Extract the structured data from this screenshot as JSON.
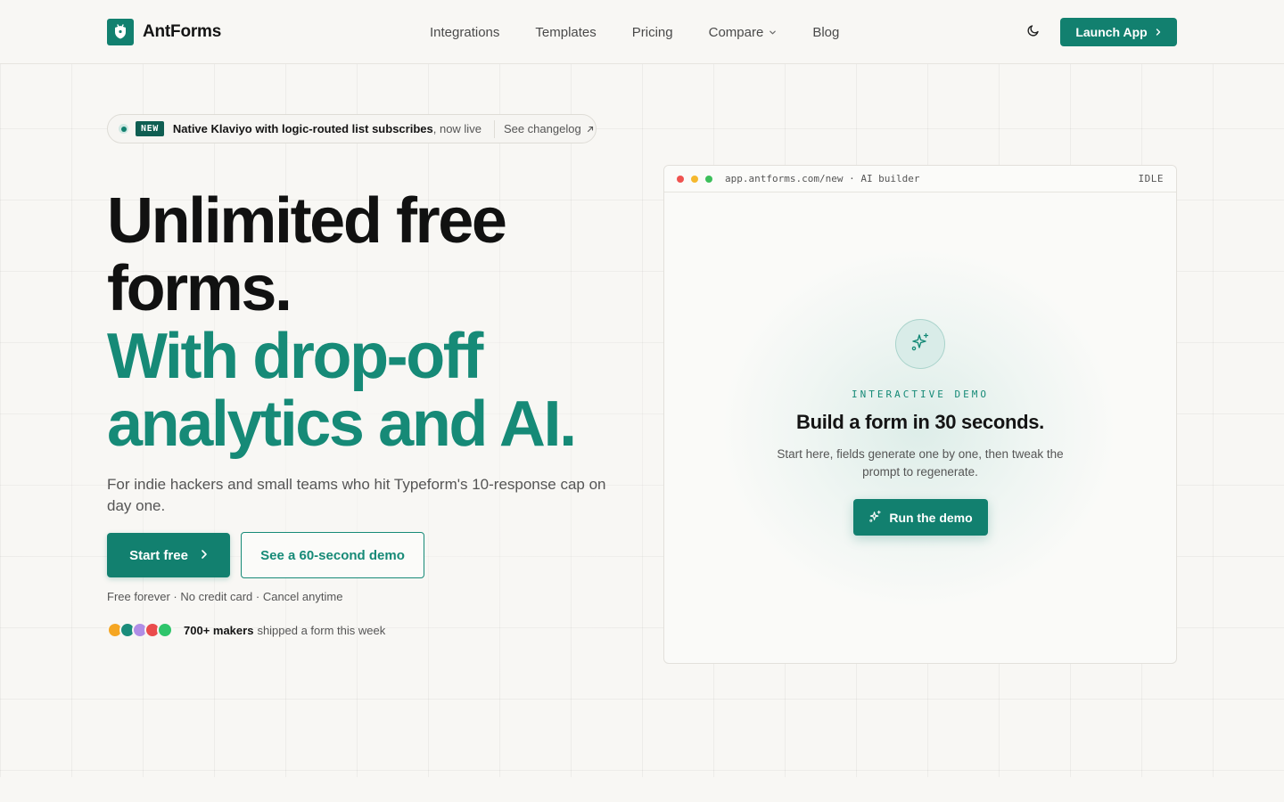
{
  "header": {
    "brand": "AntForms",
    "nav": [
      {
        "label": "Integrations"
      },
      {
        "label": "Templates"
      },
      {
        "label": "Pricing"
      },
      {
        "label": "Compare"
      },
      {
        "label": "Blog"
      }
    ],
    "launch_label": "Launch App"
  },
  "announcement": {
    "badge": "NEW",
    "headline": "Native Klaviyo with logic-routed list subscribes",
    "suffix": ", now live",
    "link": "See changelog"
  },
  "hero": {
    "title_line1": "Unlimited free",
    "title_line2": "forms.",
    "title_line3": "With drop-off",
    "title_line4": "analytics and AI.",
    "subtitle": "For indie hackers and small teams who hit Typeform's 10-response cap on day one.",
    "primary_cta": "Start free",
    "secondary_cta": "See a 60-second demo",
    "fine_print": "Free forever · No credit card · Cancel anytime",
    "social_strong": "700+ makers",
    "social_rest": "shipped a form this week"
  },
  "demo": {
    "url": "app.antforms.com/new · AI builder",
    "status": "IDLE",
    "eyebrow": "INTERACTIVE DEMO",
    "title": "Build a form in 30 seconds.",
    "description": "Start here, fields generate one by one, then tweak the prompt to regenerate.",
    "cta": "Run the demo"
  },
  "colors": {
    "brand": "#12806f",
    "accent_text": "#168a77",
    "background": "#f8f7f4",
    "avatars": [
      "#f5a623",
      "#1a8c7a",
      "#b08ee6",
      "#ea4c4c",
      "#2fc56b"
    ],
    "traffic_lights": [
      "#ef5350",
      "#f5b82e",
      "#3cbf5b"
    ]
  },
  "icons": {
    "logo": "ant-shield-icon",
    "theme": "moon-icon",
    "compare_chevron": "chevron-down-icon",
    "launch_arrow": "chevron-right-icon",
    "changelog": "arrow-up-right-icon",
    "demo_badge": "sparkles-icon"
  }
}
